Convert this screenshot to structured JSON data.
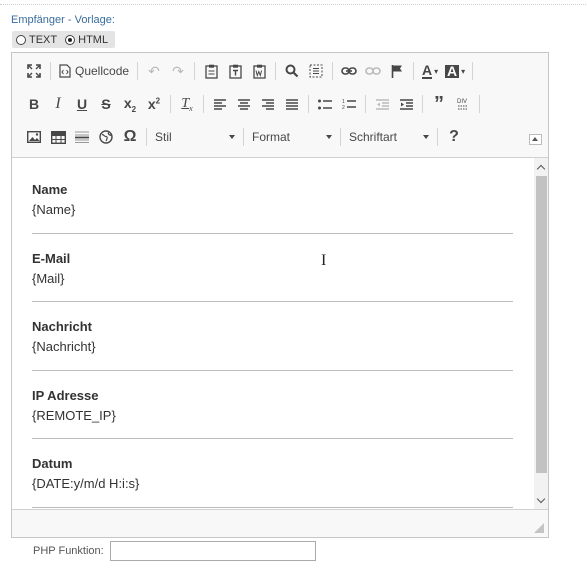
{
  "section": {
    "label": "Empfänger - Vorlage:"
  },
  "format": {
    "options": [
      "TEXT",
      "HTML"
    ],
    "selected": "HTML"
  },
  "toolbar": {
    "source_label": "Quellcode",
    "style_combo": "Stil",
    "format_combo": "Format",
    "font_combo": "Schriftart",
    "help": "?"
  },
  "fields": [
    {
      "label": "Name",
      "value": "{Name}"
    },
    {
      "label": "E-Mail",
      "value": "{Mail}"
    },
    {
      "label": "Nachricht",
      "value": "{Nachricht}"
    },
    {
      "label": "IP Adresse",
      "value": "{REMOTE_IP}"
    },
    {
      "label": "Datum",
      "value": "{DATE:y/m/d H:i:s}"
    }
  ],
  "php": {
    "label": "PHP Funktion:"
  }
}
